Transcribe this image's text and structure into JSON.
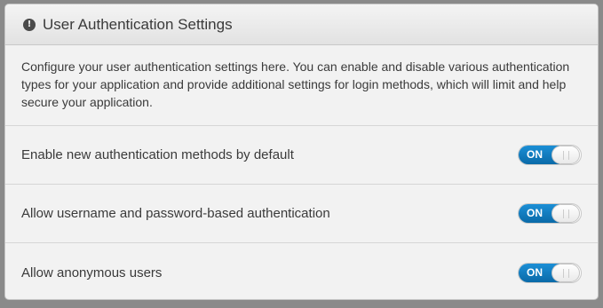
{
  "panel": {
    "title": "User Authentication Settings",
    "icon": "info-icon",
    "description": "Configure your user authentication settings here. You can enable and disable various authentication types for your application and provide additional settings for login methods, which will limit and help secure your application."
  },
  "settings": [
    {
      "label": "Enable new authentication methods by default",
      "toggle_label": "ON",
      "enabled": true
    },
    {
      "label": "Allow username and password-based authentication",
      "toggle_label": "ON",
      "enabled": true
    },
    {
      "label": "Allow anonymous users",
      "toggle_label": "ON",
      "enabled": true
    }
  ],
  "colors": {
    "toggle_on": "#1b8fd6",
    "panel_bg": "#f2f2f2",
    "text": "#3a3a3a"
  }
}
